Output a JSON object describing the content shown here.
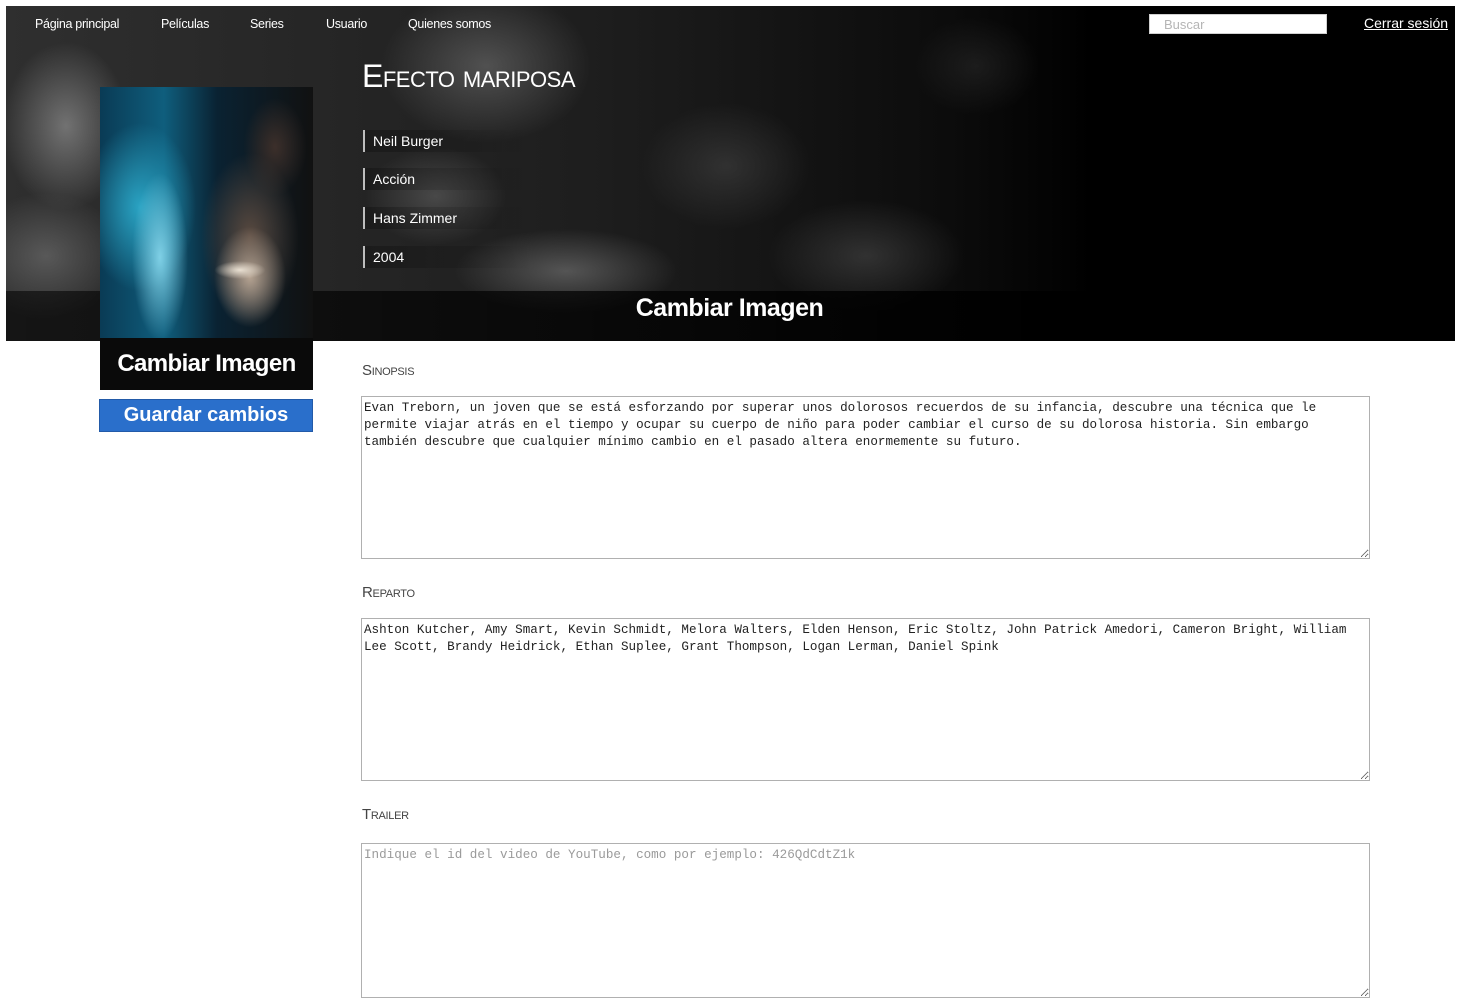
{
  "nav": {
    "links": [
      "Página principal",
      "Películas",
      "Series",
      "Usuario",
      "Quienes somos"
    ],
    "search_placeholder": "Buscar",
    "logout": "Cerrar sesión"
  },
  "movie": {
    "title": "Efecto mariposa",
    "director": "Neil Burger",
    "genre": "Acción",
    "composer": "Hans Zimmer",
    "year": "2004"
  },
  "hero": {
    "change_image": "Cambiar Imagen"
  },
  "poster": {
    "change_image": "Cambiar Imagen",
    "save": "Guardar cambios"
  },
  "form": {
    "synopsis_label": "Sinopsis",
    "synopsis_value": "Evan Treborn, un joven que se está esforzando por superar unos dolorosos recuerdos de su infancia, descubre una técnica que le permite viajar atrás en el tiempo y ocupar su cuerpo de niño para poder cambiar el curso de su dolorosa historia. Sin embargo también descubre que cualquier mínimo cambio en el pasado altera enormemente su futuro.",
    "cast_label": "Reparto",
    "cast_value": "Ashton Kutcher, Amy Smart, Kevin Schmidt, Melora Walters, Elden Henson, Eric Stoltz, John Patrick Amedori, Cameron Bright, William Lee Scott, Brandy Heidrick, Ethan Suplee, Grant Thompson, Logan Lerman, Daniel Spink",
    "trailer_label": "Trailer",
    "trailer_value": "",
    "trailer_placeholder": "Indique el id del video de YouTube, como por ejemplo: 426QdCdtZ1k"
  }
}
